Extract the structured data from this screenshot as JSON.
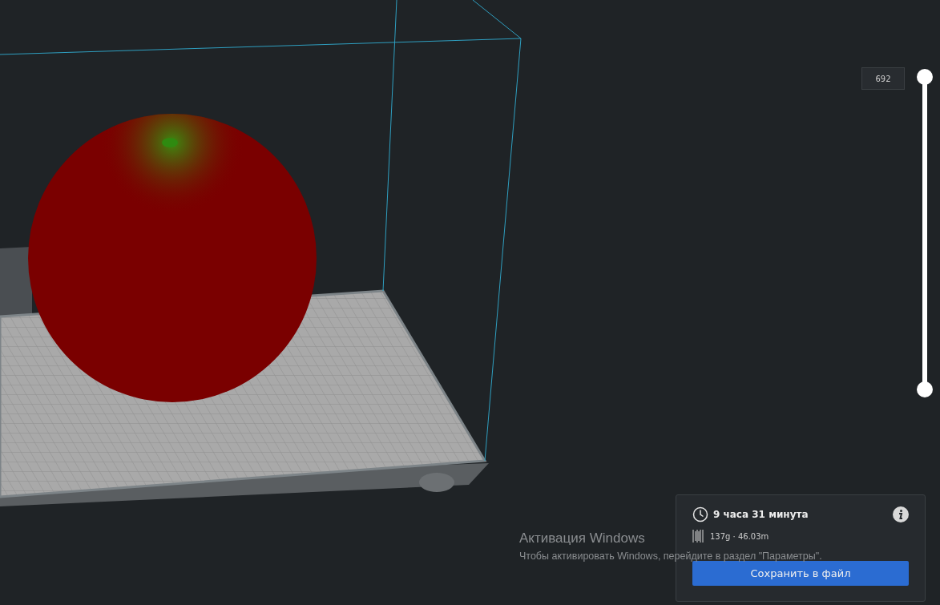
{
  "layer_slider": {
    "value": "692",
    "level": 1
  },
  "print_info": {
    "time": "9 часа 31 минута",
    "material": "137g · 46.03m",
    "button": "Сохранить в файл"
  },
  "os_notice": {
    "title": "Активация Windows",
    "text": "Чтобы активировать Windows, перейдите в раздел \"Параметры\"."
  }
}
